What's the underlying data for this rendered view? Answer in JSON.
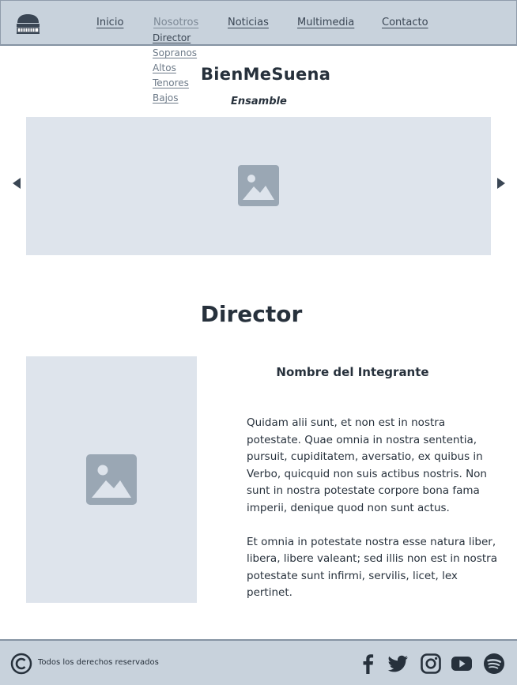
{
  "header": {
    "nav": [
      {
        "label": "Inicio"
      },
      {
        "label": "Nosotros"
      },
      {
        "label": "Noticias"
      },
      {
        "label": "Multimedia"
      },
      {
        "label": "Contacto"
      }
    ],
    "dropdown": [
      {
        "label": "Director"
      },
      {
        "label": "Sopranos"
      },
      {
        "label": "Altos"
      },
      {
        "label": "Tenores"
      },
      {
        "label": "Bajos"
      }
    ],
    "brand_title": "BienMeSuena",
    "brand_subtitle": "Ensamble"
  },
  "section": {
    "title": "Director",
    "member_name": "Nombre del Integrante",
    "bio_paragraphs": [
      "Quidam alii sunt, et non est in nostra potestate. Quae omnia in nostra sententia, pursuit, cupiditatem, aversatio, ex quibus in Verbo, quicquid non suis actibus nostris. Non sunt in nostra potestate corpore bona fama imperii, denique quod non sunt actus.",
      "Et omnia in potestate nostra esse natura liber, libera, libere valeant; sed illis non est in nostra potestate sunt infirmi, servilis, licet, lex pertinet."
    ]
  },
  "footer": {
    "copyright_text": "Todos los derechos reservados",
    "social_icons": [
      "facebook-icon",
      "twitter-icon",
      "instagram-icon",
      "youtube-icon",
      "spotify-icon"
    ]
  },
  "colors": {
    "header_bg": "#c8d2dc",
    "placeholder_bg": "#dee4ec",
    "icon_gray": "#9aa7b4",
    "text_dark": "#27313c",
    "accent_dark": "#3a4654"
  }
}
